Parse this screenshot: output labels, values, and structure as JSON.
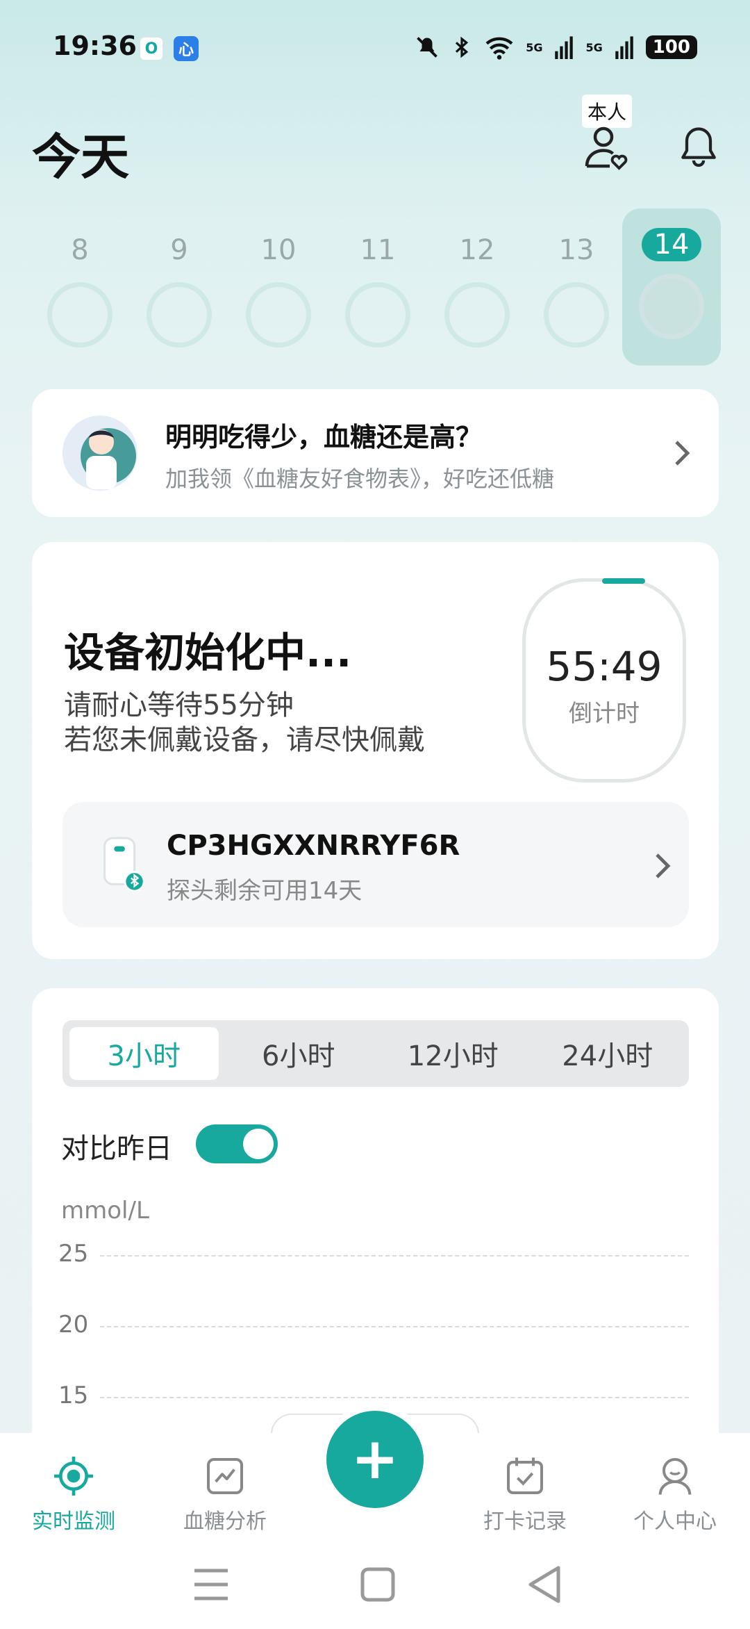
{
  "status_bar": {
    "time": "19:36",
    "badge_o": "O",
    "badge_app": "心",
    "signal_1": "5G",
    "signal_2": "5G",
    "battery": "100",
    "icons": [
      "mute-icon",
      "bluetooth-icon",
      "wifi-icon",
      "signal-icon",
      "signal-icon",
      "battery-icon"
    ]
  },
  "header": {
    "title": "今天",
    "profile_badge": "本人"
  },
  "days": [
    {
      "num": "8"
    },
    {
      "num": "9"
    },
    {
      "num": "10"
    },
    {
      "num": "11"
    },
    {
      "num": "12"
    },
    {
      "num": "13"
    },
    {
      "num": "14",
      "active": true
    }
  ],
  "promo": {
    "title": "明明吃得少，血糖还是高？",
    "subtitle": "加我领《血糖友好食物表》，好吃还低糖"
  },
  "device": {
    "title": "设备初始化中...",
    "line1": "请耐心等待55分钟",
    "line2": "若您未佩戴设备，请尽快佩戴",
    "timer_value": "55:49",
    "timer_label": "倒计时",
    "sensor_id": "CP3HGXXNRRYF6R",
    "sensor_remaining": "探头剩余可用14天"
  },
  "chart": {
    "tabs": [
      "3小时",
      "6小时",
      "12小时",
      "24小时"
    ],
    "active_tab": 0,
    "compare_label": "对比昨日",
    "compare_on": true,
    "unit": "mmol/L",
    "y_ticks": [
      "25",
      "20",
      "15"
    ]
  },
  "nav": {
    "items": [
      {
        "label": "实时监测",
        "icon": "monitor-icon",
        "active": true
      },
      {
        "label": "血糖分析",
        "icon": "analysis-icon"
      },
      {
        "label": "打卡记录",
        "icon": "calendar-check-icon"
      },
      {
        "label": "个人中心",
        "icon": "person-icon"
      }
    ],
    "fab": "+"
  },
  "colors": {
    "accent": "#17a99e"
  }
}
